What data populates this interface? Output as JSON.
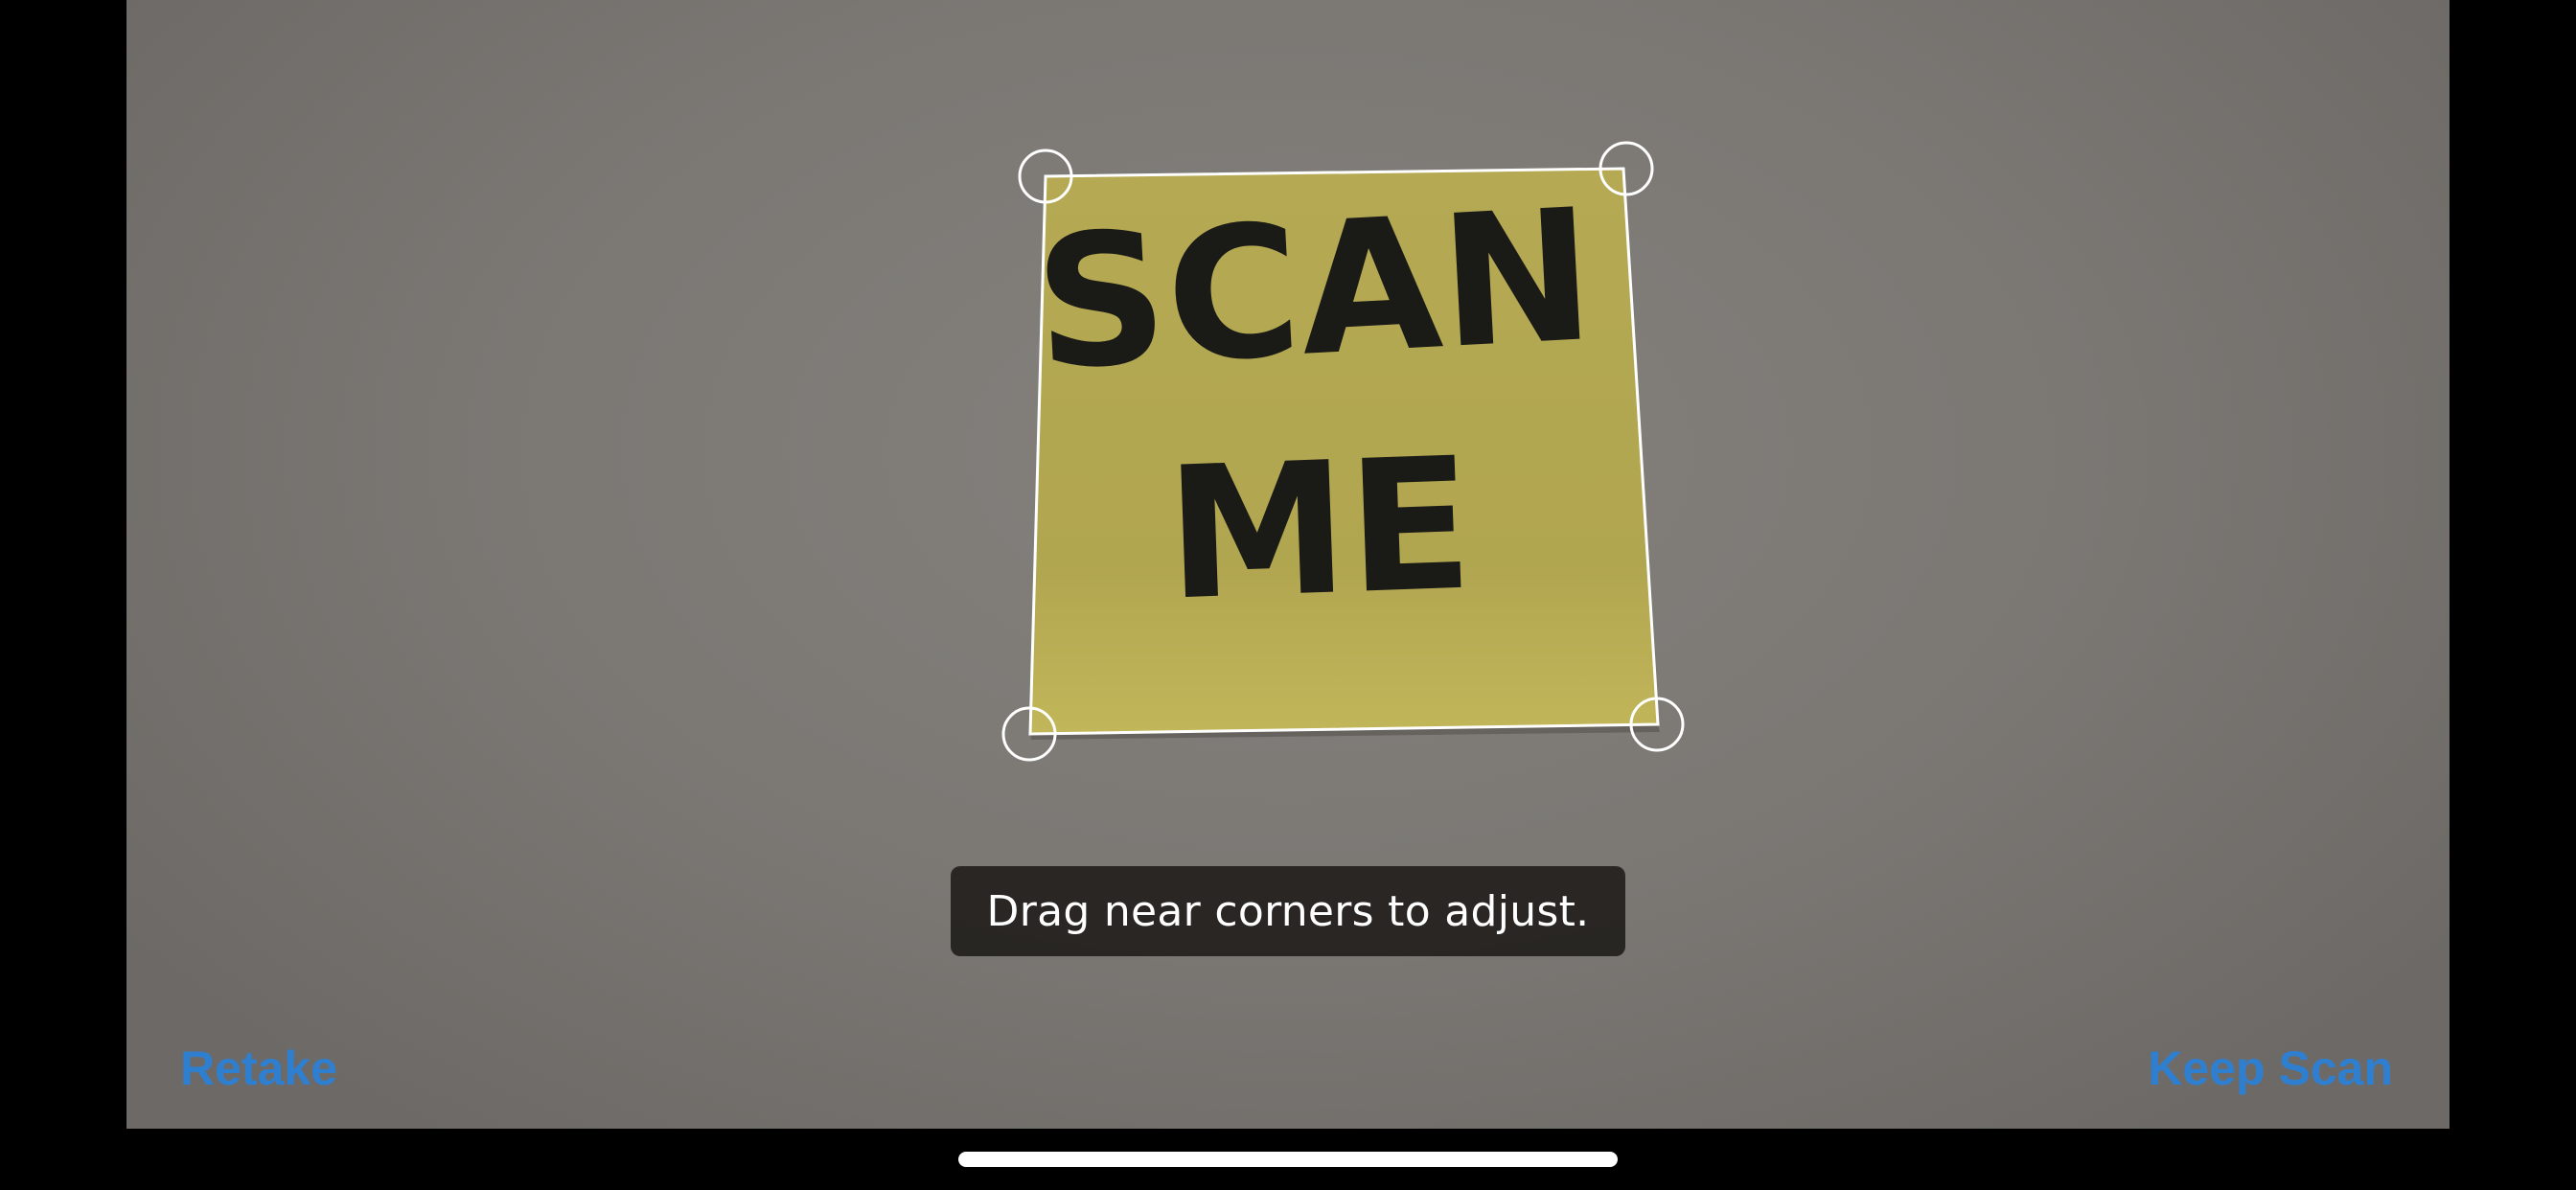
{
  "scan_review": {
    "document_text": [
      "SCAN",
      "ME"
    ],
    "hint": "Drag near corners to adjust.",
    "actions": {
      "retake_label": "Retake",
      "keep_scan_label": "Keep Scan"
    }
  },
  "colors": {
    "accent": "#2f7fd1",
    "note_yellow": "#b3a752",
    "background_gray": "#7c7975",
    "handle_white": "#ffffff",
    "toast_bg": "#221f1c"
  },
  "icons": {
    "corner_handles": "circle-outline-handle"
  }
}
